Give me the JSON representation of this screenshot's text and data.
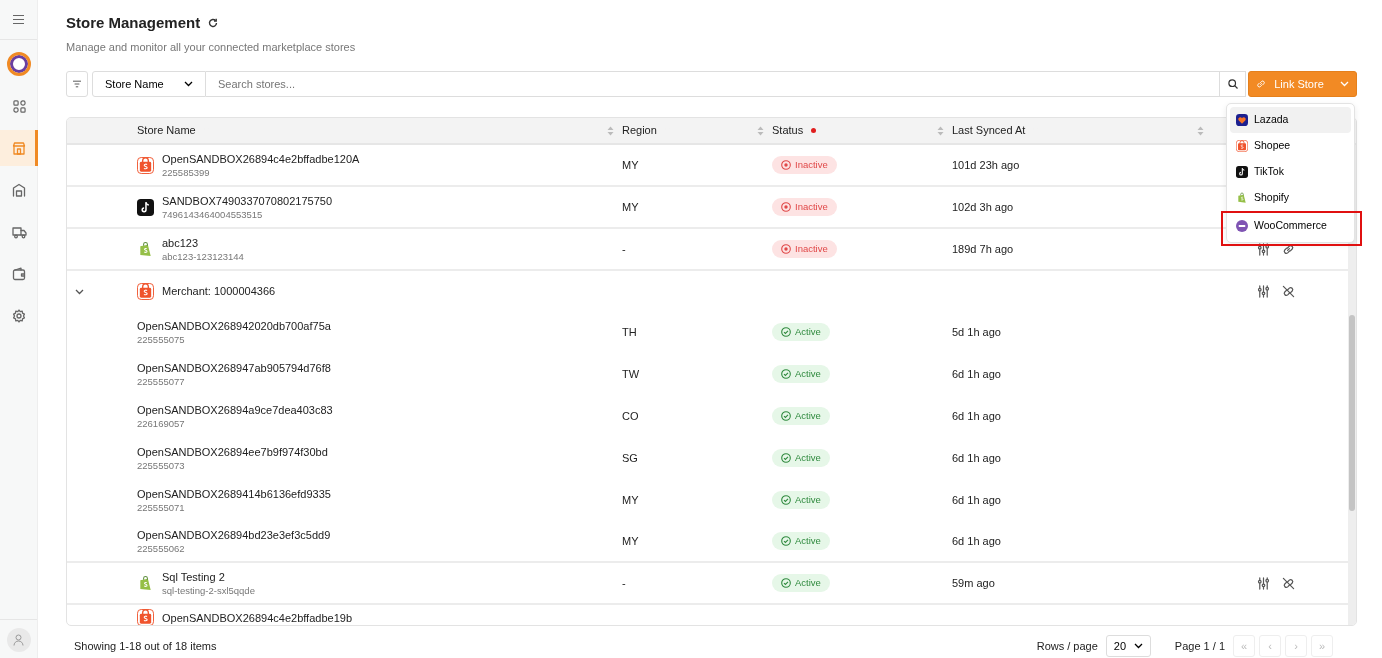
{
  "sidebar": {
    "items": [
      {
        "selected": false
      },
      {
        "selected": true
      },
      {
        "selected": false
      },
      {
        "selected": false
      },
      {
        "selected": false
      },
      {
        "selected": false
      }
    ]
  },
  "header": {
    "title": "Store Management",
    "subtitle": "Manage and monitor all your connected marketplace stores"
  },
  "toolbar": {
    "field_select": "Store Name",
    "search": {
      "placeholder": "Search stores..."
    },
    "link_button": "Link Store"
  },
  "link_menu": [
    {
      "label": "Lazada",
      "kind": "lazada",
      "selected": true,
      "highlighted": false
    },
    {
      "label": "Shopee",
      "kind": "shopee",
      "selected": false,
      "highlighted": false
    },
    {
      "label": "TikTok",
      "kind": "tiktok",
      "selected": false,
      "highlighted": false
    },
    {
      "label": "Shopify",
      "kind": "shopify",
      "selected": false,
      "highlighted": false
    },
    {
      "label": "WooCommerce",
      "kind": "woocommerce",
      "selected": false,
      "highlighted": true
    }
  ],
  "table": {
    "columns": [
      {
        "label": "Store Name",
        "filter_active": false
      },
      {
        "label": "Region",
        "filter_active": false
      },
      {
        "label": "Status",
        "filter_active": true
      },
      {
        "label": "Last Synced At",
        "filter_active": false
      }
    ],
    "rows": [
      {
        "kind": "store",
        "logo": {
          "kind": "shopee"
        },
        "name": "OpenSANDBOX26894c4e2bffadbe120A",
        "id": "225585399",
        "region": "MY",
        "status": {
          "label": "Inactive",
          "kind": "inactive"
        },
        "synced": "101d 23h ago",
        "actions": []
      },
      {
        "kind": "store",
        "logo": {
          "kind": "tiktok"
        },
        "name": "SANDBOX7490337070802175750",
        "id": "7496143464004553515",
        "region": "MY",
        "status": {
          "label": "Inactive",
          "kind": "inactive"
        },
        "synced": "102d 3h ago",
        "actions": []
      },
      {
        "kind": "store",
        "logo": {
          "kind": "shopify"
        },
        "name": "abc123",
        "id": "abc123-123123144",
        "region": "-",
        "status": {
          "label": "Inactive",
          "kind": "inactive"
        },
        "synced": "189d 7h ago",
        "actions": [
          {
            "kind": "adjust"
          },
          {
            "kind": "link"
          }
        ]
      },
      {
        "kind": "group",
        "logo": {
          "kind": "shopee"
        },
        "name": "Merchant: 1000004366",
        "expanded": true,
        "actions": [
          {
            "kind": "adjust"
          },
          {
            "kind": "unlink"
          }
        ],
        "children": [
          {
            "name": "OpenSANDBOX268942020db700af75a",
            "id": "225555075",
            "region": "TH",
            "status": {
              "label": "Active",
              "kind": "active"
            },
            "synced": "5d 1h ago"
          },
          {
            "name": "OpenSANDBOX268947ab905794d76f8",
            "id": "225555077",
            "region": "TW",
            "status": {
              "label": "Active",
              "kind": "active"
            },
            "synced": "6d 1h ago"
          },
          {
            "name": "OpenSANDBOX26894a9ce7dea403c83",
            "id": "226169057",
            "region": "CO",
            "status": {
              "label": "Active",
              "kind": "active"
            },
            "synced": "6d 1h ago"
          },
          {
            "name": "OpenSANDBOX26894ee7b9f974f30bd",
            "id": "225555073",
            "region": "SG",
            "status": {
              "label": "Active",
              "kind": "active"
            },
            "synced": "6d 1h ago"
          },
          {
            "name": "OpenSANDBOX2689414b6136efd9335",
            "id": "225555071",
            "region": "MY",
            "status": {
              "label": "Active",
              "kind": "active"
            },
            "synced": "6d 1h ago"
          },
          {
            "name": "OpenSANDBOX26894bd23e3ef3c5dd9",
            "id": "225555062",
            "region": "MY",
            "status": {
              "label": "Active",
              "kind": "active"
            },
            "synced": "6d 1h ago"
          }
        ]
      },
      {
        "kind": "store",
        "logo": {
          "kind": "shopify"
        },
        "name": "Sql Testing 2",
        "id": "sql-testing-2-sxl5qqde",
        "region": "-",
        "status": {
          "label": "Active",
          "kind": "active"
        },
        "synced": "59m ago",
        "actions": [
          {
            "kind": "adjust"
          },
          {
            "kind": "unlink"
          }
        ]
      },
      {
        "kind": "store",
        "logo": {
          "kind": "shopee"
        },
        "name": "OpenSANDBOX26894c4e2bffadbe19b",
        "actions": []
      }
    ]
  },
  "footer": {
    "showing": "Showing 1-18 out of 18 items",
    "rows_label": "Rows / page",
    "rows_value": "20",
    "page": "Page 1 / 1",
    "pager": [
      {
        "label": "«",
        "disabled": true
      },
      {
        "label": "‹",
        "disabled": true
      },
      {
        "label": "›",
        "disabled": true
      },
      {
        "label": "»",
        "disabled": true
      }
    ]
  }
}
